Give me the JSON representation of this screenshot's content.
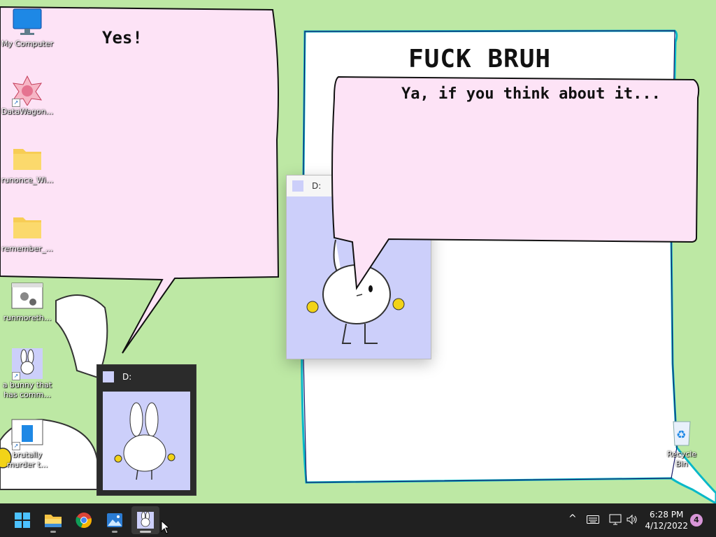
{
  "desktop": {
    "icons": [
      {
        "label": "My Computer",
        "icon": "monitor-icon"
      },
      {
        "label": "DataWagon...",
        "icon": "datawagon-icon"
      },
      {
        "label": "runonce_Wi...",
        "icon": "folder-icon"
      },
      {
        "label": "remember_...",
        "icon": "folder-icon"
      },
      {
        "label": "runmoreth...",
        "icon": "settings-app-icon"
      },
      {
        "label": "a bunny that\nhas comm...",
        "icon": "bunny-icon"
      },
      {
        "label": "brutally\nmurder t...",
        "icon": "app-window-icon"
      }
    ],
    "recycle_bin": "Recycle Bin"
  },
  "bubbles": {
    "left_text": "Yes!",
    "right_text": "Ya, if you think about it...",
    "big_title": "FUCK BRUH"
  },
  "windows": {
    "center_title": "D:",
    "thumb_title": "D:"
  },
  "taskbar": {
    "apps": [
      "start-icon",
      "file-explorer-icon",
      "chrome-icon",
      "photos-icon",
      "bunny-app-icon"
    ],
    "time": "6:28 PM",
    "date": "4/12/2022",
    "notification_count": "4"
  },
  "colors": {
    "desktop": "#bde8a4",
    "bubble_pink": "#fde3f6",
    "bunny_bg": "#cccffa",
    "taskbar": "#202020"
  }
}
